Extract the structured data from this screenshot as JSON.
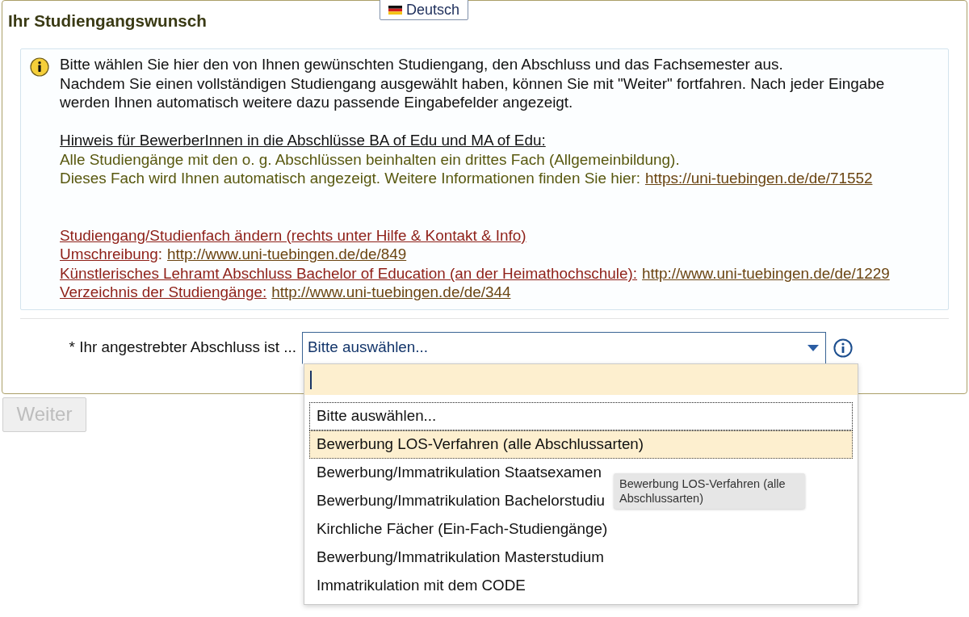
{
  "language_switcher": {
    "label": "Deutsch"
  },
  "section": {
    "title": "Ihr Studiengangswunsch"
  },
  "info_box": {
    "intro": [
      "Bitte wählen Sie hier den von Ihnen gewünschten Studiengang, den Abschluss und das Fachsemester aus.",
      "Nachdem Sie einen vollständigen Studiengang ausgewählt haben, können Sie mit \"Weiter\" fortfahren. Nach jeder Eingabe werden Ihnen automatisch weitere dazu passende Eingabefelder angezeigt."
    ],
    "notice": {
      "heading": "Hinweis für BewerberInnen in die Abschlüsse BA of Edu und MA of Edu:",
      "lines": [
        {
          "text": "Alle Studiengänge mit den o. g. Abschlüssen beinhalten ein drittes Fach (Allgemeinbildung)."
        },
        {
          "text": "Dieses Fach wird Ihnen automatisch angezeigt. Weitere Informationen finden Sie hier:",
          "url": "https://uni-tuebingen.de/de/71552"
        }
      ]
    },
    "links": [
      {
        "label": "Studiengang/Studienfach ändern (rechts unter Hilfe & Kontakt & Info)"
      },
      {
        "label": "Umschreibung",
        "suffix": ":",
        "url": "http://www.uni-tuebingen.de/de/849"
      },
      {
        "label": "Künstlerisches Lehramt Abschluss Bachelor of Education (an der Heimathochschule):",
        "url": "http://www.uni-tuebingen.de/de/1229"
      },
      {
        "label": "Verzeichnis der Studiengänge:",
        "url": "http://www.uni-tuebingen.de/de/344"
      }
    ]
  },
  "degree_field": {
    "label": "* Ihr angestrebter Abschluss ist ...",
    "value": "Bitte auswählen...",
    "expanded": true
  },
  "dropdown": {
    "search": {
      "focused": true
    },
    "options": [
      {
        "label": "Bitte auswählen...",
        "selected": true,
        "highlighted": false
      },
      {
        "label": "Bewerbung LOS-Verfahren (alle Abschlussarten)",
        "selected": false,
        "highlighted": true
      },
      {
        "label": "Bewerbung/Immatrikulation Staatsexamen",
        "selected": false,
        "highlighted": false
      },
      {
        "label": "Bewerbung/Immatrikulation Bachelorstudiu",
        "selected": false,
        "highlighted": false
      },
      {
        "label": "Kirchliche Fächer (Ein-Fach-Studiengänge)",
        "selected": false,
        "highlighted": false
      },
      {
        "label": "Bewerbung/Immatrikulation Masterstudium",
        "selected": false,
        "highlighted": false
      },
      {
        "label": "Immatrikulation mit dem CODE",
        "selected": false,
        "highlighted": false
      }
    ],
    "tooltip": {
      "text": "Bewerbung LOS-Verfahren (alle Abschlussarten)"
    }
  },
  "next_button": {
    "label": "Weiter",
    "disabled": true
  }
}
